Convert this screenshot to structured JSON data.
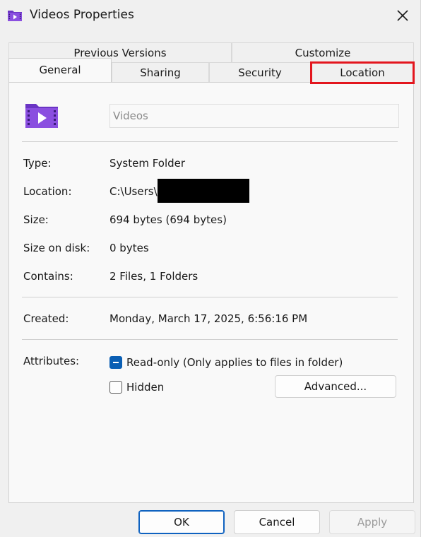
{
  "window": {
    "title": "Videos Properties",
    "title_icon": "video-folder-icon",
    "close_icon": "close-icon"
  },
  "tabs": {
    "back_row": [
      {
        "label": "Previous Versions"
      },
      {
        "label": "Customize"
      }
    ],
    "front_row": [
      {
        "label": "General",
        "active": true
      },
      {
        "label": "Sharing"
      },
      {
        "label": "Security"
      },
      {
        "label": "Location",
        "highlighted": true
      }
    ]
  },
  "general": {
    "folder_icon": "video-folder-icon",
    "name_value": "Videos",
    "rows": {
      "type": {
        "label": "Type:",
        "value": "System Folder"
      },
      "location": {
        "label": "Location:",
        "value": "C:\\Users\\"
      },
      "size": {
        "label": "Size:",
        "value": "694 bytes (694 bytes)"
      },
      "size_on_disk": {
        "label": "Size on disk:",
        "value": "0 bytes"
      },
      "contains": {
        "label": "Contains:",
        "value": "2 Files, 1 Folders"
      },
      "created": {
        "label": "Created:",
        "value": "Monday, March 17, 2025, 6:56:16 PM"
      }
    },
    "attributes": {
      "label": "Attributes:",
      "readonly": {
        "label": "Read-only (Only applies to files in folder)",
        "state": "indeterminate"
      },
      "hidden": {
        "label": "Hidden",
        "state": "unchecked"
      },
      "advanced_label": "Advanced..."
    }
  },
  "buttons": {
    "ok": "OK",
    "cancel": "Cancel",
    "apply": "Apply"
  },
  "colors": {
    "accent": "#0a5fb4",
    "highlight": "#e3161e",
    "folder": "#7a3fd0"
  }
}
